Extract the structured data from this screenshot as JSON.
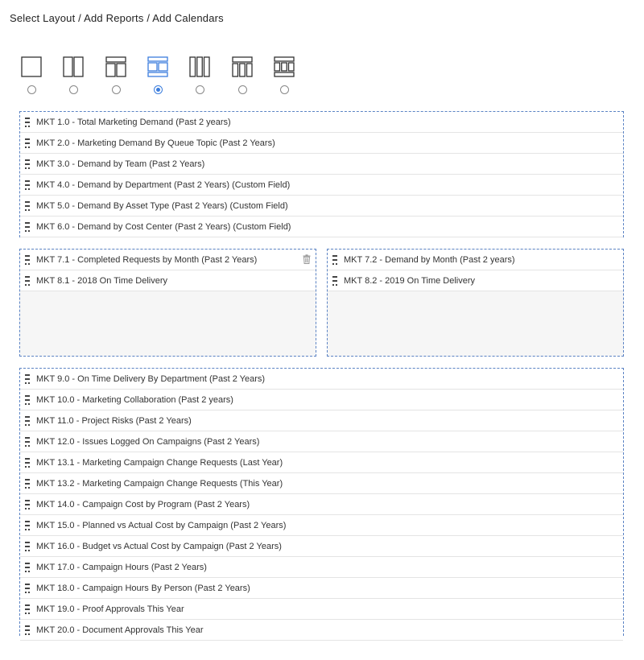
{
  "page": {
    "title": "Select Layout / Add Reports / Add Calendars"
  },
  "layouts": {
    "selected_index": 3,
    "options": [
      {
        "name": "layout-single-column-icon"
      },
      {
        "name": "layout-two-column-icon"
      },
      {
        "name": "layout-header-two-column-icon"
      },
      {
        "name": "layout-header-two-column-footer-icon"
      },
      {
        "name": "layout-three-column-icon"
      },
      {
        "name": "layout-header-three-column-icon"
      },
      {
        "name": "layout-header-three-column-footer-icon"
      }
    ]
  },
  "zones": {
    "top": [
      "MKT 1.0 - Total Marketing Demand (Past 2 years)",
      "MKT 2.0 - Marketing Demand By Queue Topic (Past 2 Years)",
      "MKT 3.0 - Demand by Team (Past 2 Years)",
      "MKT 4.0 - Demand by Department (Past 2 Years) (Custom Field)",
      "MKT 5.0 - Demand By Asset Type (Past 2 Years) (Custom Field)",
      "MKT 6.0 - Demand by Cost Center (Past 2 Years) (Custom Field)"
    ],
    "left": [
      "MKT 7.1 - Completed Requests by Month (Past 2 Years)",
      "MKT 8.1 - 2018 On Time Delivery"
    ],
    "right": [
      "MKT 7.2 - Demand by Month (Past 2 years)",
      "MKT 8.2 - 2019 On Time Delivery"
    ],
    "bottom": [
      "MKT 9.0 - On Time Delivery By Department (Past 2 Years)",
      "MKT 10.0 - Marketing Collaboration (Past 2 years)",
      "MKT 11.0 - Project Risks (Past 2 Years)",
      "MKT 12.0 - Issues Logged On Campaigns (Past 2 Years)",
      "MKT 13.1 - Marketing Campaign Change Requests (Last Year)",
      "MKT 13.2 - Marketing Campaign Change Requests (This Year)",
      "MKT 14.0 - Campaign Cost by Program (Past 2 Years)",
      "MKT 15.0 - Planned vs Actual Cost by Campaign (Past 2 Years)",
      "MKT 16.0 - Budget vs Actual Cost by Campaign (Past 2 Years)",
      "MKT 17.0 - Campaign Hours (Past 2 Years)",
      "MKT 18.0 - Campaign Hours By Person (Past 2 Years)",
      "MKT 19.0 - Proof Approvals This Year",
      "MKT 20.0 - Document Approvals This Year"
    ]
  },
  "icons": {
    "drag": "drag-handle-icon",
    "trash": "trash-icon"
  },
  "colors": {
    "accent": "#3b7ddd",
    "zone_border": "#5b83c4"
  }
}
